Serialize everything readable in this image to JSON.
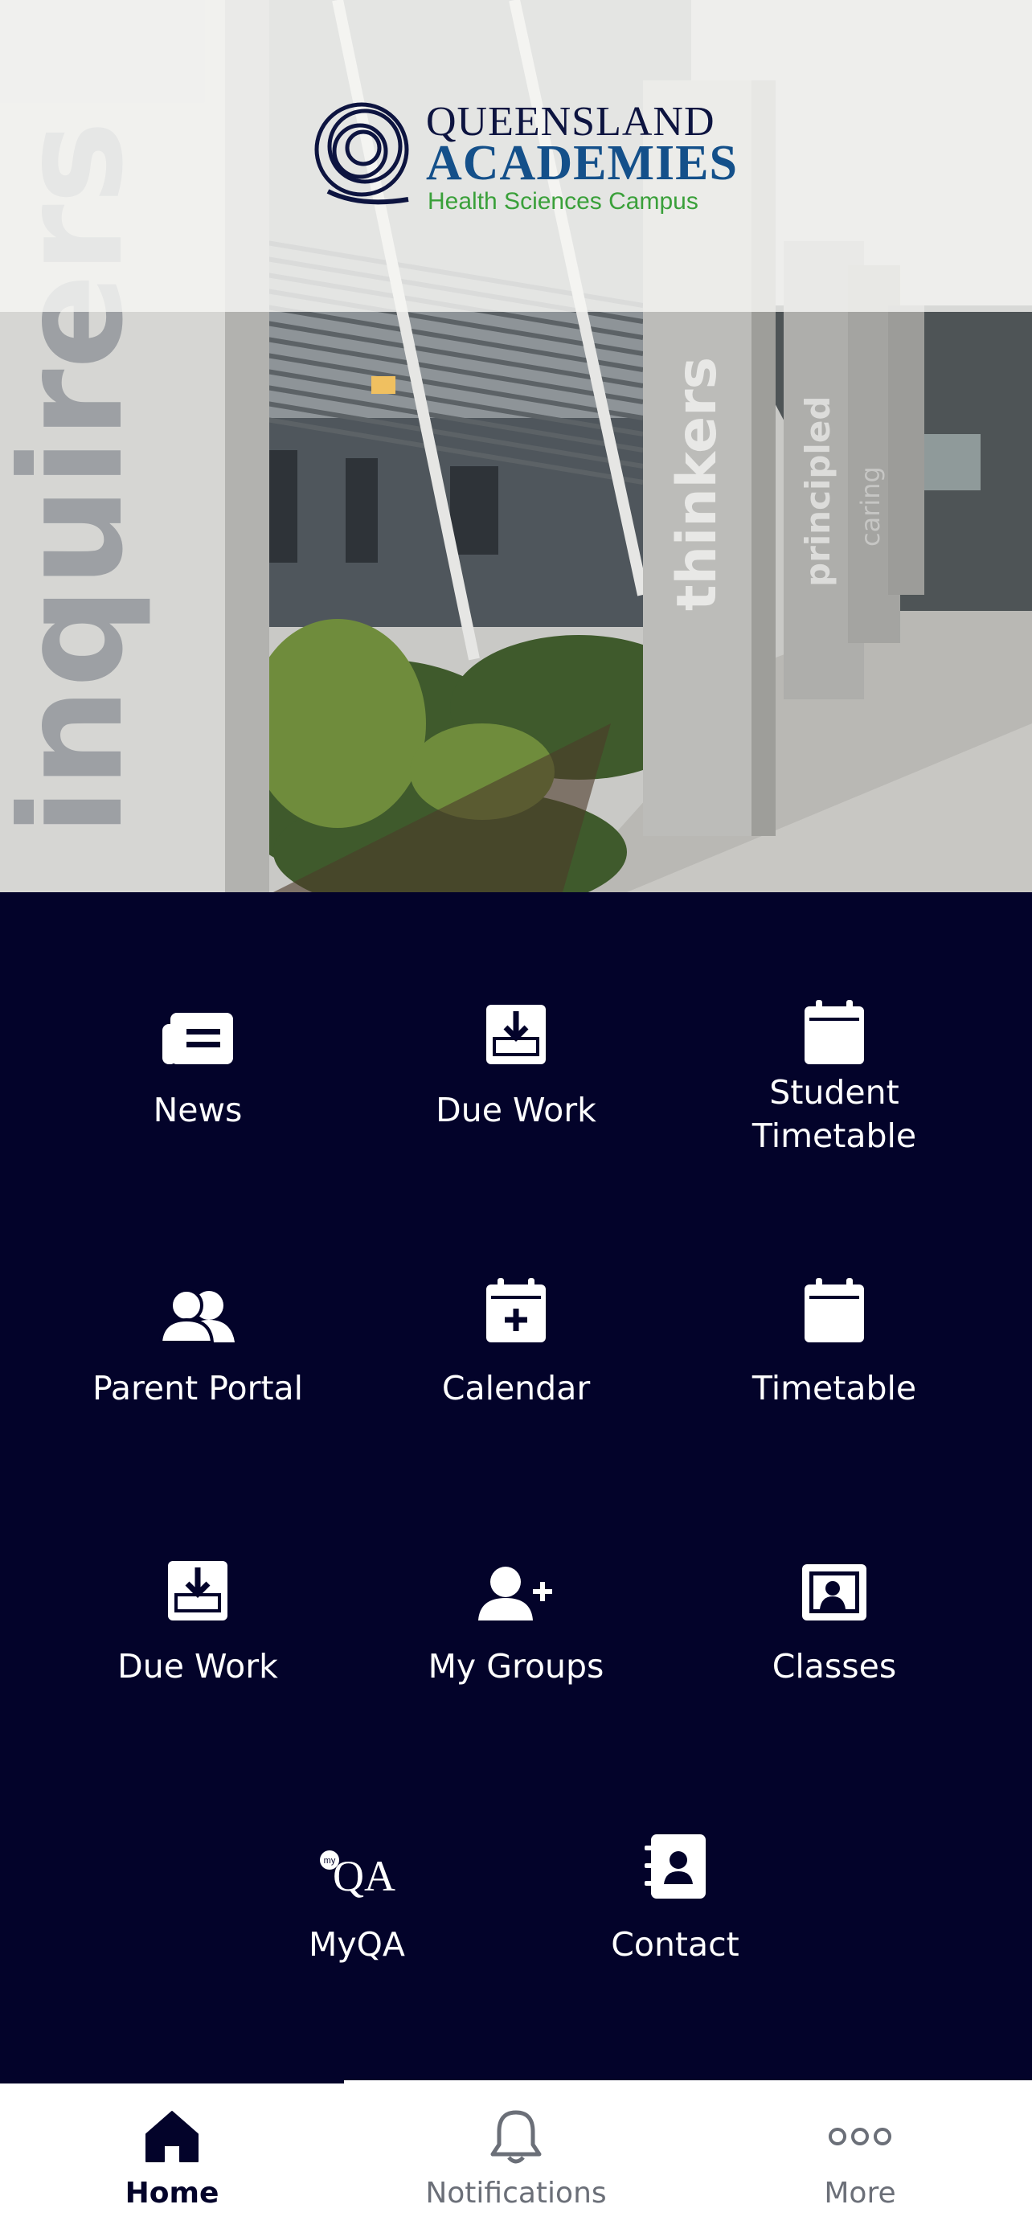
{
  "hero": {
    "logo": {
      "line1": "QUEENSLAND",
      "line2": "ACADEMIES",
      "line3": "Health Sciences Campus"
    },
    "pillar_words": [
      "inquirers",
      "thinkers",
      "principled",
      "caring"
    ]
  },
  "menu": [
    {
      "label": "News",
      "icon": "newspaper-icon"
    },
    {
      "label": "Due Work",
      "icon": "download-icon"
    },
    {
      "label": "Student\nTimetable",
      "icon": "calendar-icon"
    },
    {
      "label": "Parent Portal",
      "icon": "users-icon"
    },
    {
      "label": "Calendar",
      "icon": "calendar-plus-icon"
    },
    {
      "label": "Timetable",
      "icon": "calendar-icon"
    },
    {
      "label": "Due Work",
      "icon": "download-icon"
    },
    {
      "label": "My Groups",
      "icon": "user-plus-icon"
    },
    {
      "label": "Classes",
      "icon": "classroom-icon"
    },
    {
      "label": "MyQA",
      "icon": "myqa-logo-icon",
      "icon_text": "QA",
      "icon_badge": "my"
    },
    {
      "label": "Contact",
      "icon": "contact-book-icon"
    }
  ],
  "tabs": [
    {
      "label": "Home",
      "icon": "home-icon",
      "active": true
    },
    {
      "label": "Notifications",
      "icon": "bell-icon",
      "active": false
    },
    {
      "label": "More",
      "icon": "more-dots-icon",
      "active": false
    }
  ],
  "colors": {
    "background": "#03032a",
    "logo_navy": "#0d1440",
    "logo_blue": "#14508a",
    "logo_green": "#3aa03a",
    "tab_inactive": "#6b6f78"
  }
}
